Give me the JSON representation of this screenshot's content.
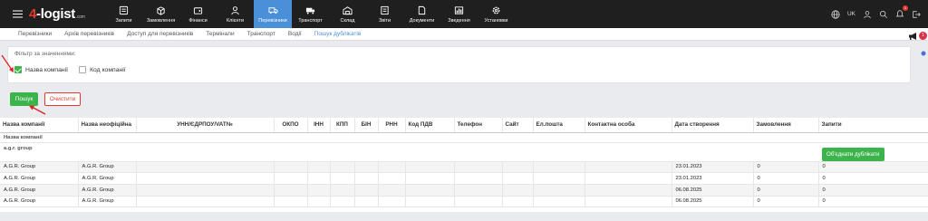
{
  "app": {
    "logo_prefix": "",
    "logo_num": "4",
    "logo_text": "-logist",
    "logo_suffix": ".com"
  },
  "nav": [
    {
      "label": "Запити",
      "icon": "requests-icon"
    },
    {
      "label": "Замовлення",
      "icon": "orders-icon"
    },
    {
      "label": "Фінанси",
      "icon": "finance-icon"
    },
    {
      "label": "Клієнти",
      "icon": "clients-icon"
    },
    {
      "label": "Перевізники",
      "icon": "truck-icon"
    },
    {
      "label": "Транспорт",
      "icon": "transport-icon"
    },
    {
      "label": "Склад",
      "icon": "warehouse-icon"
    },
    {
      "label": "Звіти",
      "icon": "reports-icon"
    },
    {
      "label": "Документи",
      "icon": "documents-icon"
    },
    {
      "label": "Зведення",
      "icon": "summary-icon"
    },
    {
      "label": "Установки",
      "icon": "settings-icon"
    }
  ],
  "topright": {
    "lang": "UK",
    "notif_count": "1"
  },
  "subtabs": [
    {
      "label": "Перевізники"
    },
    {
      "label": "Архів перевізників"
    },
    {
      "label": "Доступ для перевізників"
    },
    {
      "label": "Термінали"
    },
    {
      "label": "Транспорт"
    },
    {
      "label": "Водії"
    },
    {
      "label": "Пошук дублікатів"
    }
  ],
  "side": {
    "badge": "1"
  },
  "filter": {
    "title": "Фільтр за значеннями:",
    "options": [
      {
        "label": "Назва компанії",
        "checked": true
      },
      {
        "label": "Код компанії",
        "checked": false
      }
    ]
  },
  "buttons": {
    "search": "Пошук",
    "clear": "Очистити",
    "merge": "Об'єднати дублікати"
  },
  "table": {
    "columns": [
      "Назва компанії",
      "Назва неофіційна",
      "УНН/ЄДРПОУ/VAT№",
      "ОКПО",
      "ІНН",
      "КПП",
      "БІН",
      "РНН",
      "Код ПДВ",
      "Телефон",
      "Сайт",
      "Ел.пошта",
      "Контактна особа",
      "Дата створення",
      "Замовлення",
      "Запити"
    ],
    "group_by_label": "Назва компанії",
    "group_name": "a.g.r. group",
    "rows": [
      [
        "A.G.R. Group",
        "A.G.R. Group",
        "",
        "",
        "",
        "",
        "",
        "",
        "",
        "",
        "",
        "",
        "",
        "23.01.2023",
        "0",
        "0"
      ],
      [
        "A.G.R. Group",
        "A.G.R. Group",
        "",
        "",
        "",
        "",
        "",
        "",
        "",
        "",
        "",
        "",
        "",
        "23.01.2023",
        "0",
        "0"
      ],
      [
        "A.G.R. Group",
        "A.G.R. Group",
        "",
        "",
        "",
        "",
        "",
        "",
        "",
        "",
        "",
        "",
        "",
        "06.08.2025",
        "0",
        "0"
      ],
      [
        "A.G.R. Group",
        "A.G.R. Group",
        "",
        "",
        "",
        "",
        "",
        "",
        "",
        "",
        "",
        "",
        "",
        "06.08.2025",
        "0",
        "0"
      ]
    ]
  },
  "colors": {
    "topbar": "#1f1f1f",
    "active_nav": "#4a90d9",
    "green": "#3cb44b",
    "red": "#e5392f"
  }
}
